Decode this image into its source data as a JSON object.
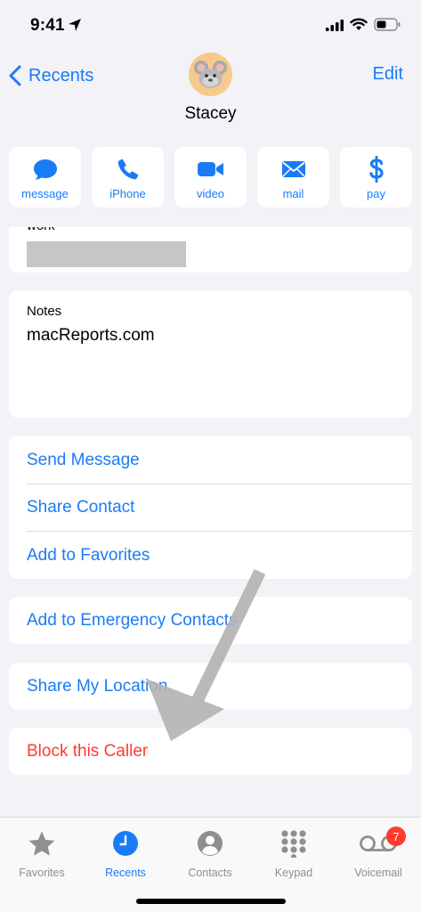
{
  "status_bar": {
    "time": "9:41"
  },
  "nav": {
    "back_label": "Recents",
    "edit_label": "Edit"
  },
  "contact": {
    "name": "Stacey"
  },
  "actions": [
    {
      "label": "message",
      "icon": "message-bubble-icon"
    },
    {
      "label": "iPhone",
      "icon": "phone-icon"
    },
    {
      "label": "video",
      "icon": "video-camera-icon"
    },
    {
      "label": "mail",
      "icon": "envelope-icon"
    },
    {
      "label": "pay",
      "icon": "dollar-icon"
    }
  ],
  "work": {
    "label": "work"
  },
  "notes": {
    "label": "Notes",
    "value": "macReports.com"
  },
  "list": [
    {
      "label": "Send Message"
    },
    {
      "label": "Share Contact"
    },
    {
      "label": "Add to Favorites"
    }
  ],
  "emergency": {
    "label": "Add to Emergency Contacts"
  },
  "share_location": {
    "label": "Share My Location"
  },
  "block": {
    "label": "Block this Caller"
  },
  "tabs": [
    {
      "label": "Favorites",
      "icon": "star-icon",
      "active": false
    },
    {
      "label": "Recents",
      "icon": "clock-icon",
      "active": true
    },
    {
      "label": "Contacts",
      "icon": "person-circle-icon",
      "active": false
    },
    {
      "label": "Keypad",
      "icon": "keypad-icon",
      "active": false
    },
    {
      "label": "Voicemail",
      "icon": "voicemail-icon",
      "active": false,
      "badge": "7"
    }
  ],
  "colors": {
    "accent": "#1a7cf5",
    "destructive": "#ff3b30",
    "background": "#f2f2f7",
    "annotation_arrow": "#b4b4b4"
  }
}
